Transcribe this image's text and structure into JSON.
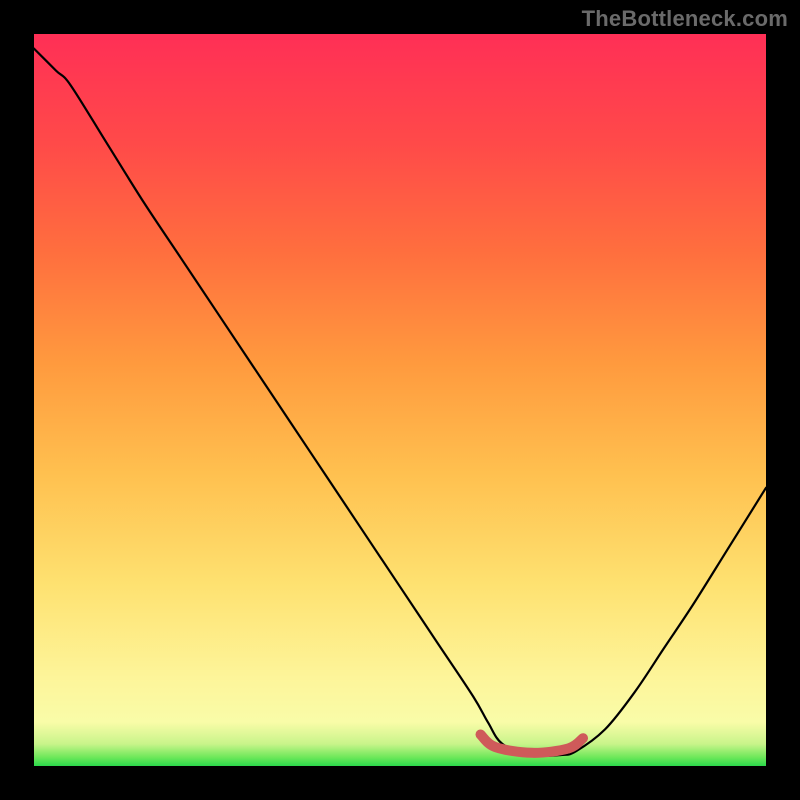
{
  "watermark": "TheBottleneck.com",
  "colors": {
    "frame": "#000000",
    "curve": "#000000",
    "highlight": "#cf5a5a",
    "gradient_top": "#ff2f56",
    "gradient_bottom": "#2bd94b"
  },
  "chart_data": {
    "type": "line",
    "title": "",
    "xlabel": "",
    "ylabel": "",
    "xlim": [
      0,
      100
    ],
    "ylim": [
      0,
      100
    ],
    "x": [
      0,
      3,
      5,
      10,
      15,
      20,
      25,
      30,
      35,
      40,
      45,
      50,
      55,
      60,
      62,
      64,
      68,
      72,
      74,
      78,
      82,
      86,
      90,
      95,
      100
    ],
    "series": [
      {
        "name": "bottleneck-curve",
        "values": [
          98,
          95,
          93,
          85,
          77,
          69.5,
          62,
          54.5,
          47,
          39.5,
          32,
          24.5,
          17,
          9.5,
          6,
          3,
          1.5,
          1.5,
          2,
          5,
          10,
          16,
          22,
          30,
          38
        ]
      }
    ],
    "highlight_range_x": [
      61,
      75
    ],
    "highlight_y": 1.8,
    "annotations": []
  }
}
